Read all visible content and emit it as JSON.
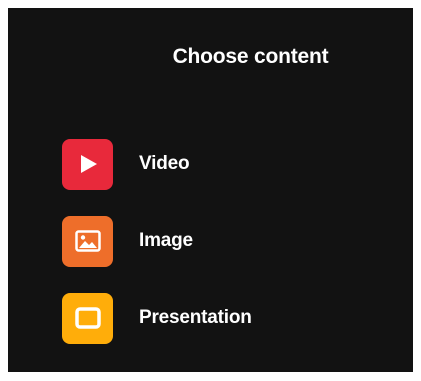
{
  "dialog": {
    "title": "Choose content"
  },
  "options": [
    {
      "label": "Video",
      "icon": "play-icon",
      "color": "#e8293b"
    },
    {
      "label": "Image",
      "icon": "image-icon",
      "color": "#ee6e2a"
    },
    {
      "label": "Presentation",
      "icon": "presentation-icon",
      "color": "#ffad0a"
    }
  ]
}
